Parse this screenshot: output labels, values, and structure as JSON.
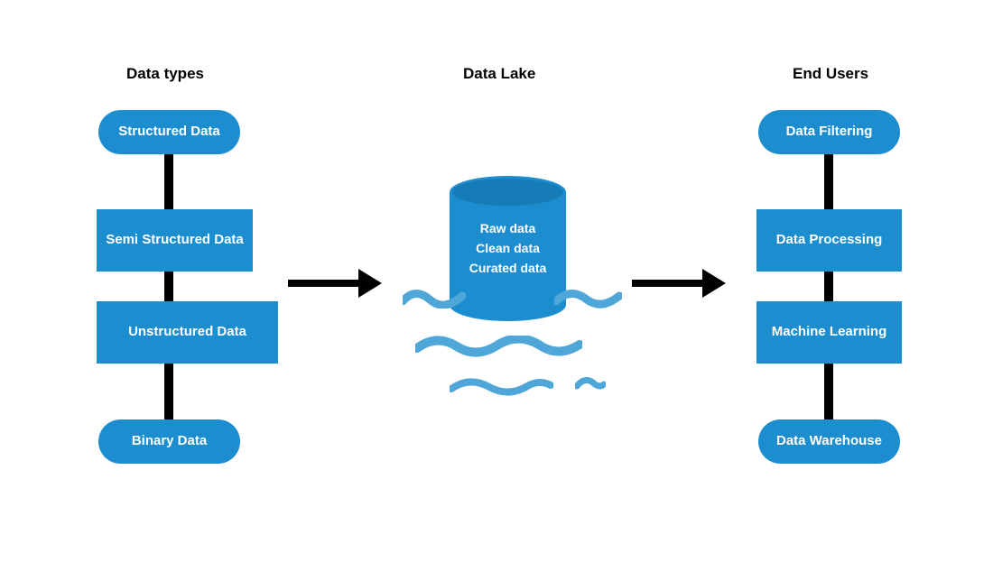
{
  "colors": {
    "accent": "#1C8DCE",
    "accent_dark": "#167CB8",
    "wave": "#4EA7D8",
    "text": "#000000",
    "bg": "#FFFFFF"
  },
  "headings": {
    "left": "Data types",
    "center": "Data Lake",
    "right": "End Users"
  },
  "left_col": {
    "items": [
      {
        "shape": "pill",
        "label": "Structured Data"
      },
      {
        "shape": "rect",
        "label": "Semi Structured Data"
      },
      {
        "shape": "rect",
        "label": "Unstructured Data"
      },
      {
        "shape": "pill",
        "label": "Binary Data"
      }
    ]
  },
  "right_col": {
    "items": [
      {
        "shape": "pill",
        "label": "Data Filtering"
      },
      {
        "shape": "rect",
        "label": "Data Processing"
      },
      {
        "shape": "rect",
        "label": "Machine Learning"
      },
      {
        "shape": "pill",
        "label": "Data Warehouse"
      }
    ]
  },
  "center_cylinder": {
    "lines": [
      "Raw data",
      "Clean data",
      "Curated data"
    ]
  }
}
